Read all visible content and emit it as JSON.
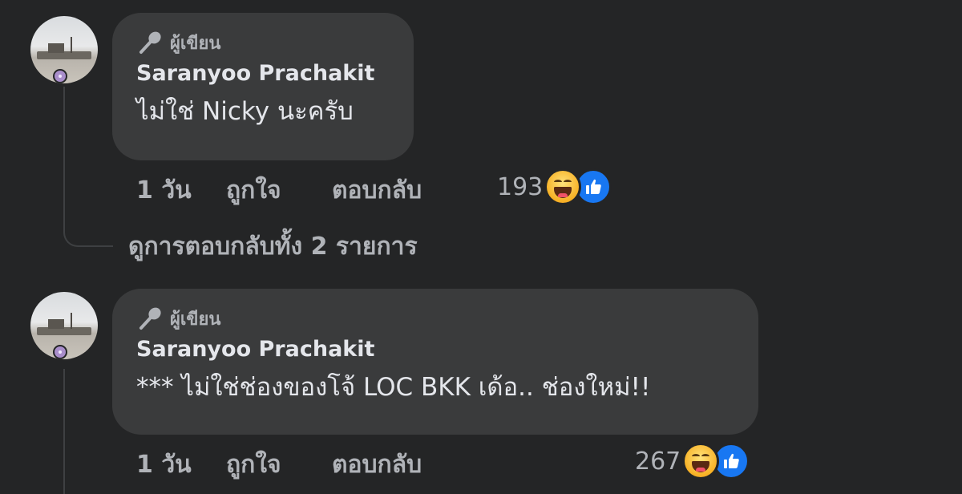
{
  "comments": [
    {
      "author_badge": "ผู้เขียน",
      "name": "Saranyoo Prachakit",
      "text": "ไม่ใช่ Nicky นะครับ",
      "time": "1 วัน",
      "like_label": "ถูกใจ",
      "reply_label": "ตอบกลับ",
      "reaction_count": "193",
      "reactions": [
        "haha-icon",
        "like-icon"
      ]
    },
    {
      "author_badge": "ผู้เขียน",
      "name": "Saranyoo Prachakit",
      "text": "*** ไม่ใช่ช่องของโจ้ LOC BKK เด้อ.. ช่องใหม่!!",
      "time": "1 วัน",
      "like_label": "ถูกใจ",
      "reply_label": "ตอบกลับ",
      "reaction_count": "267",
      "reactions": [
        "haha-icon",
        "like-icon"
      ]
    }
  ],
  "view_replies_label": "ดูการตอบกลับทั้ง 2 รายการ",
  "colors": {
    "background": "#242526",
    "bubble": "#3a3b3c",
    "primary_text": "#e4e6eb",
    "secondary_text": "#b0b3b8",
    "like_blue": "#1877f2"
  }
}
